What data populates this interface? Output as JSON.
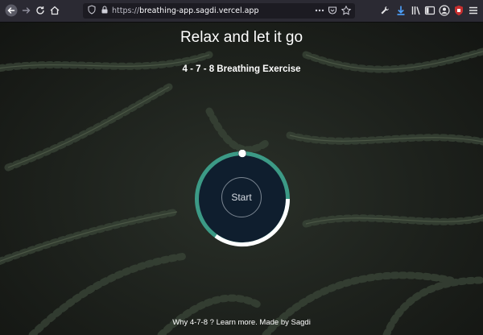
{
  "browser": {
    "url_scheme": "https://",
    "url_host": "breathing-app.sagdi.vercel.app",
    "icons": {
      "back": "back-arrow-icon",
      "forward": "forward-arrow-icon",
      "reload": "reload-icon",
      "home": "home-icon",
      "shield": "tracking-shield-icon",
      "lock": "lock-icon",
      "page_actions": "more-icon",
      "pocket": "pocket-icon",
      "bookmark": "star-icon",
      "extensions": "wrench-icon",
      "downloads": "download-icon",
      "library": "library-icon",
      "sidebar": "sidebar-icon",
      "account": "account-icon",
      "ublock": "ublock-icon",
      "menu": "hamburger-menu-icon"
    }
  },
  "app": {
    "title": "Relax and let it go",
    "subtitle": "4 - 7 - 8 Breathing Exercise",
    "start_label": "Start",
    "footer": "Why 4-7-8 ? Learn more. Made by Sagdi",
    "colors": {
      "circle_fill": "#0f1e2e",
      "ring_white": "#ffffff",
      "ring_teal": "#3c9a86"
    }
  }
}
